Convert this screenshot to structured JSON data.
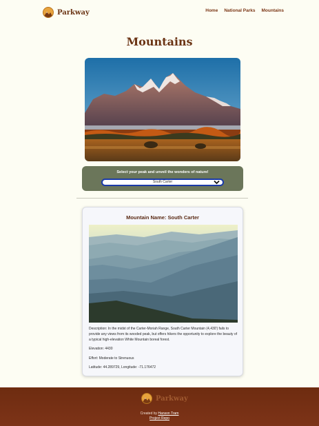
{
  "brand": {
    "name": "Parkway"
  },
  "nav": {
    "links": [
      "Home",
      "National Parks",
      "Mountains"
    ]
  },
  "page": {
    "title": "Mountains"
  },
  "picker": {
    "label": "Select your peak and unveil the wonders of nature!",
    "selected": "South Carter"
  },
  "mountain": {
    "title": "Mountain Name: South Carter",
    "description": "Description: In the midst of the Carter-Moriah Range, South Carter Mountain (4,430') fails to provide any views from its wooded peak, but offers hikers the opportunity to explore the beauty of a typical high-elevation White Mountain boreal forest.",
    "elevation": "Elevation: 4430",
    "effort": "Effort: Moderate to Strenuous",
    "coords": "Latitude: 44.289729, Longitude: -71.176472"
  },
  "footer": {
    "brand": "Parkway",
    "created_prefix": "Created by",
    "author": "Hanson Tram",
    "repo": "Project Repo"
  },
  "colors": {
    "background": "#fdfdf3",
    "brand_brown": "#6b3414",
    "picker_green": "#6b765a",
    "select_border": "#1a3aa8",
    "footer": "#6e2c10"
  }
}
